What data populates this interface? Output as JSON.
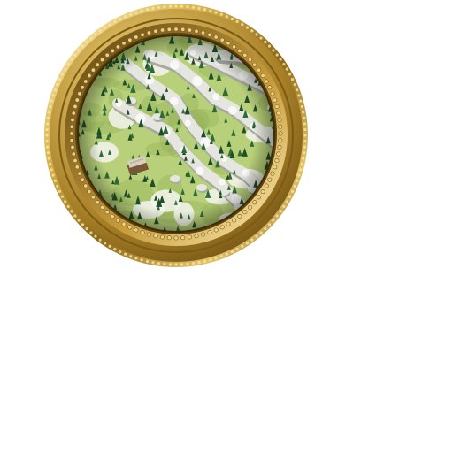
{
  "minimap": {
    "frame_style": "gold-ornate-round",
    "terrain": {
      "grass_color": "#b8d07a",
      "grass_dark_color": "#8fae52",
      "cliff_color": "#e6e6e0",
      "cliff_shadow_color": "#a9a9a2",
      "snow_color": "#f4f4f0",
      "tree_color": "#1f4f2a",
      "tree_light_color": "#2f6b36"
    },
    "building": {
      "icon": "town-building-icon",
      "roof_color": "#d8d0c0",
      "wall_color": "#7a5638"
    },
    "frame_colors": {
      "gold_light": "#f7e7a2",
      "gold_mid": "#c9a44a",
      "gold_dark": "#7a5a16",
      "bead_color": "#e9d28a"
    }
  }
}
